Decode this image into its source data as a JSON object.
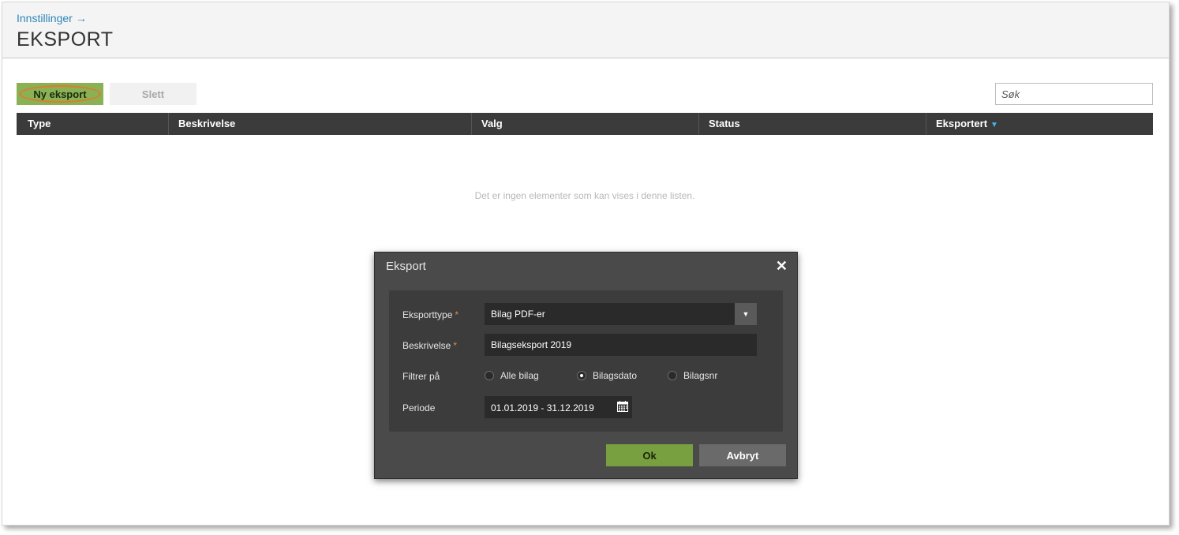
{
  "header": {
    "breadcrumb": "Innstillinger",
    "breadcrumb_arrow": "→",
    "title": "EKSPORT"
  },
  "toolbar": {
    "new_label": "Ny eksport",
    "delete_label": "Slett",
    "search_placeholder": "Søk"
  },
  "table": {
    "columns": [
      "Type",
      "Beskrivelse",
      "Valg",
      "Status",
      "Eksportert"
    ],
    "sorted_column": "Eksportert",
    "sort_direction": "descending",
    "empty_message": "Det er ingen elementer som kan vises i denne listen."
  },
  "modal": {
    "title": "Eksport",
    "fields": {
      "export_type_label": "Eksporttype",
      "export_type_value": "Bilag PDF-er",
      "description_label": "Beskrivelse",
      "description_value": "Bilagseksport 2019",
      "filter_label": "Filtrer på",
      "filter_options": [
        "Alle bilag",
        "Bilagsdato",
        "Bilagsnr"
      ],
      "filter_selected": "Bilagsdato",
      "period_label": "Periode",
      "period_value": "01.01.2019 - 31.12.2019"
    },
    "required_marker": "*",
    "ok_label": "Ok",
    "cancel_label": "Avbryt"
  },
  "colors": {
    "accent_green": "#8ab154",
    "link_blue": "#2f86b6",
    "highlight_ring": "#e07a2e",
    "required": "#e8893a"
  }
}
